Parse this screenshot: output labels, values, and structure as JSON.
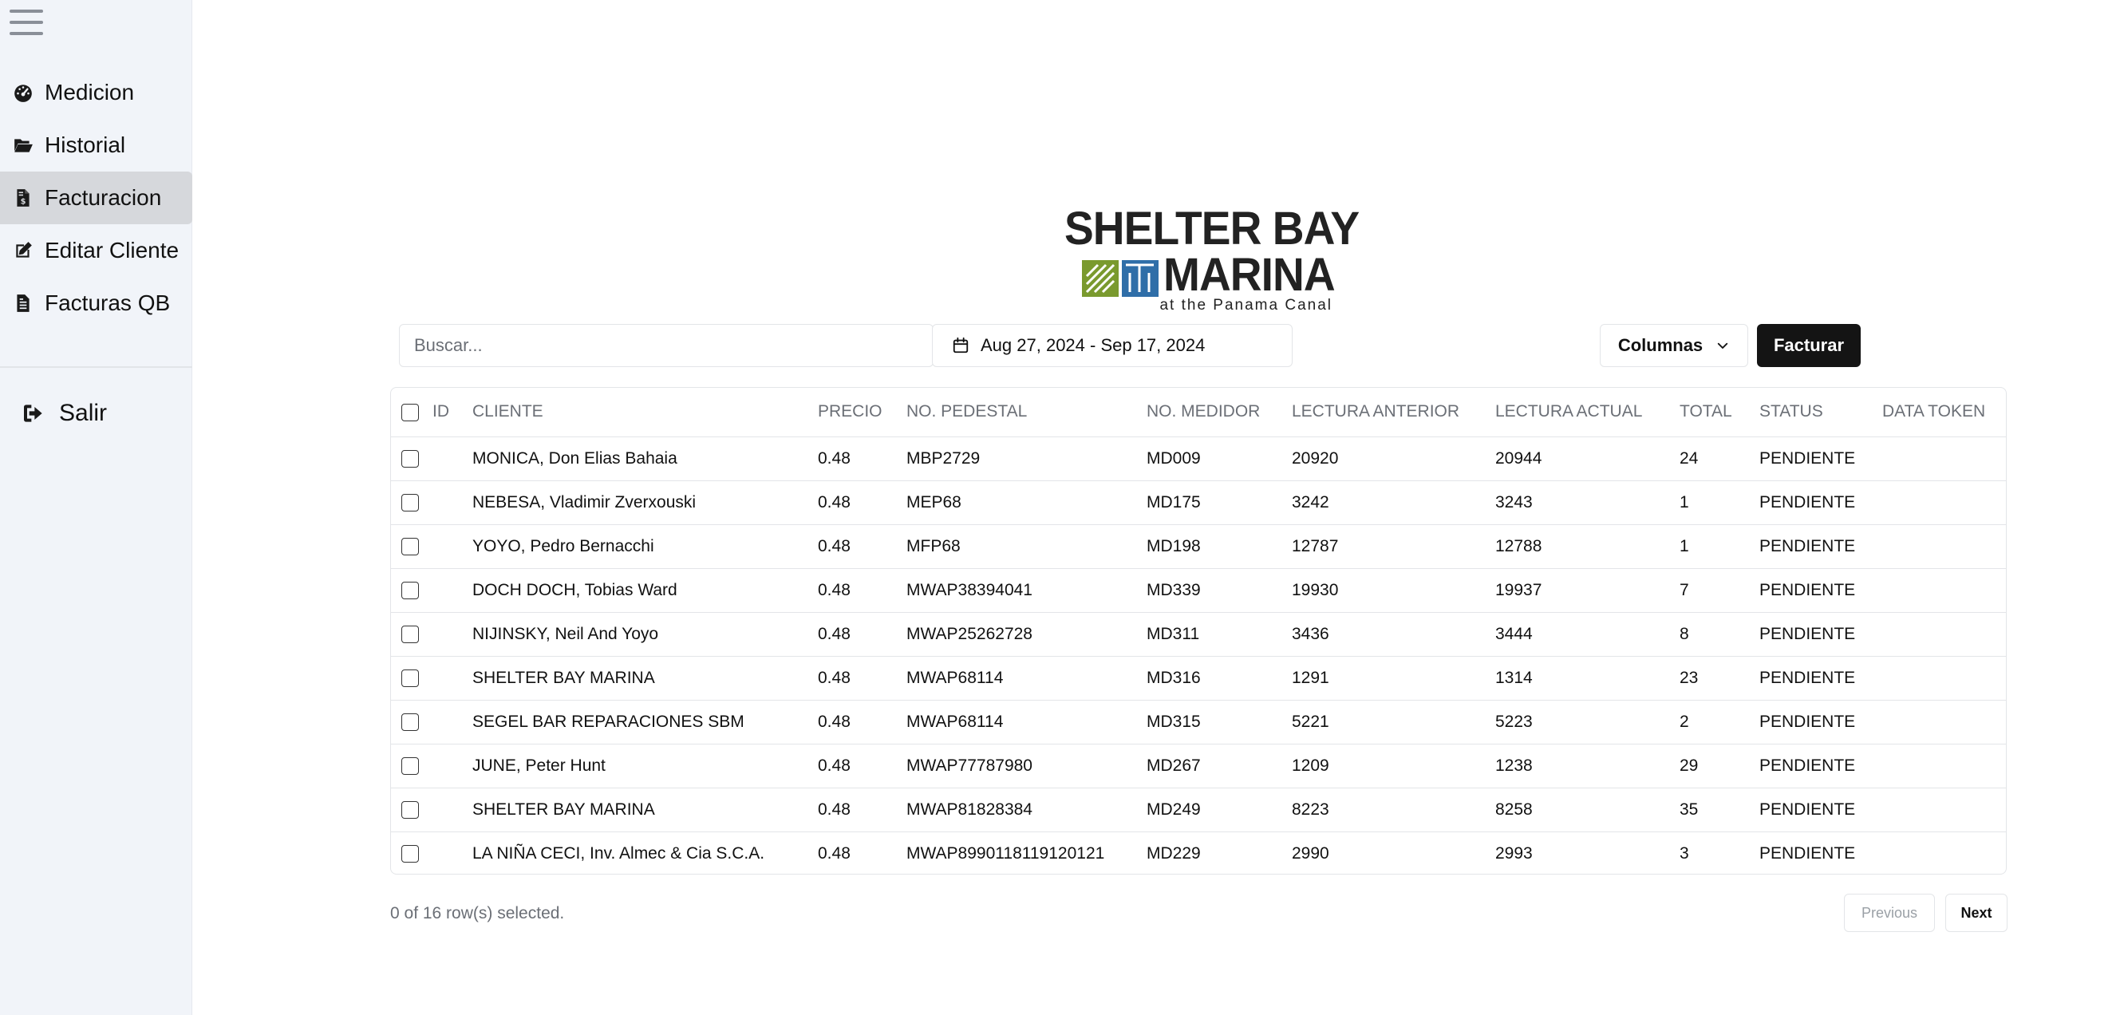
{
  "sidebar": {
    "items": [
      {
        "label": "Medicion",
        "icon": "gauge-icon"
      },
      {
        "label": "Historial",
        "icon": "folder-open-icon"
      },
      {
        "label": "Facturacion",
        "icon": "invoice-dollar-icon",
        "active": true
      },
      {
        "label": "Editar Cliente",
        "icon": "edit-icon"
      },
      {
        "label": "Facturas QB",
        "icon": "file-text-icon"
      }
    ],
    "logout_label": "Salir"
  },
  "logo": {
    "line1": "SHELTER BAY",
    "line2": "MARINA",
    "line3": "at the Panama Canal",
    "colors": {
      "green": "#7a9a2e",
      "blue": "#2f6ea8",
      "text": "#222222"
    }
  },
  "toolbar": {
    "search_placeholder": "Buscar...",
    "search_value": "",
    "date_range": "Aug 27, 2024 - Sep 17, 2024",
    "columns_label": "Columnas",
    "facturar_label": "Facturar"
  },
  "table": {
    "headers": [
      "ID",
      "CLIENTE",
      "PRECIO",
      "NO. PEDESTAL",
      "NO. MEDIDOR",
      "LECTURA ANTERIOR",
      "LECTURA ACTUAL",
      "TOTAL",
      "STATUS",
      "DATA TOKEN"
    ],
    "rows": [
      {
        "id": "",
        "cliente": "MONICA, Don Elias Bahaia",
        "precio": "0.48",
        "pedestal": "MBP2729",
        "medidor": "MD009",
        "anterior": "20920",
        "actual": "20944",
        "total": "24",
        "status": "PENDIENTE",
        "token": ""
      },
      {
        "id": "",
        "cliente": "NEBESA, Vladimir Zverxouski",
        "precio": "0.48",
        "pedestal": "MEP68",
        "medidor": "MD175",
        "anterior": "3242",
        "actual": "3243",
        "total": "1",
        "status": "PENDIENTE",
        "token": ""
      },
      {
        "id": "",
        "cliente": "YOYO, Pedro Bernacchi",
        "precio": "0.48",
        "pedestal": "MFP68",
        "medidor": "MD198",
        "anterior": "12787",
        "actual": "12788",
        "total": "1",
        "status": "PENDIENTE",
        "token": ""
      },
      {
        "id": "",
        "cliente": "DOCH DOCH, Tobias Ward",
        "precio": "0.48",
        "pedestal": "MWAP38394041",
        "medidor": "MD339",
        "anterior": "19930",
        "actual": "19937",
        "total": "7",
        "status": "PENDIENTE",
        "token": ""
      },
      {
        "id": "",
        "cliente": "NIJINSKY, Neil And Yoyo",
        "precio": "0.48",
        "pedestal": "MWAP25262728",
        "medidor": "MD311",
        "anterior": "3436",
        "actual": "3444",
        "total": "8",
        "status": "PENDIENTE",
        "token": ""
      },
      {
        "id": "",
        "cliente": "SHELTER BAY MARINA",
        "precio": "0.48",
        "pedestal": "MWAP68114",
        "medidor": "MD316",
        "anterior": "1291",
        "actual": "1314",
        "total": "23",
        "status": "PENDIENTE",
        "token": ""
      },
      {
        "id": "",
        "cliente": "SEGEL BAR REPARACIONES SBM",
        "precio": "0.48",
        "pedestal": "MWAP68114",
        "medidor": "MD315",
        "anterior": "5221",
        "actual": "5223",
        "total": "2",
        "status": "PENDIENTE",
        "token": ""
      },
      {
        "id": "",
        "cliente": "JUNE, Peter Hunt",
        "precio": "0.48",
        "pedestal": "MWAP77787980",
        "medidor": "MD267",
        "anterior": "1209",
        "actual": "1238",
        "total": "29",
        "status": "PENDIENTE",
        "token": ""
      },
      {
        "id": "",
        "cliente": "SHELTER BAY MARINA",
        "precio": "0.48",
        "pedestal": "MWAP81828384",
        "medidor": "MD249",
        "anterior": "8223",
        "actual": "8258",
        "total": "35",
        "status": "PENDIENTE",
        "token": ""
      },
      {
        "id": "",
        "cliente": "LA NIÑA CECI, Inv. Almec & Cia S.C.A.",
        "precio": "0.48",
        "pedestal": "MWAP8990118119120121",
        "medidor": "MD229",
        "anterior": "2990",
        "actual": "2993",
        "total": "3",
        "status": "PENDIENTE",
        "token": ""
      }
    ]
  },
  "footer": {
    "selection_text": "0 of 16 row(s) selected.",
    "previous_label": "Previous",
    "next_label": "Next"
  }
}
